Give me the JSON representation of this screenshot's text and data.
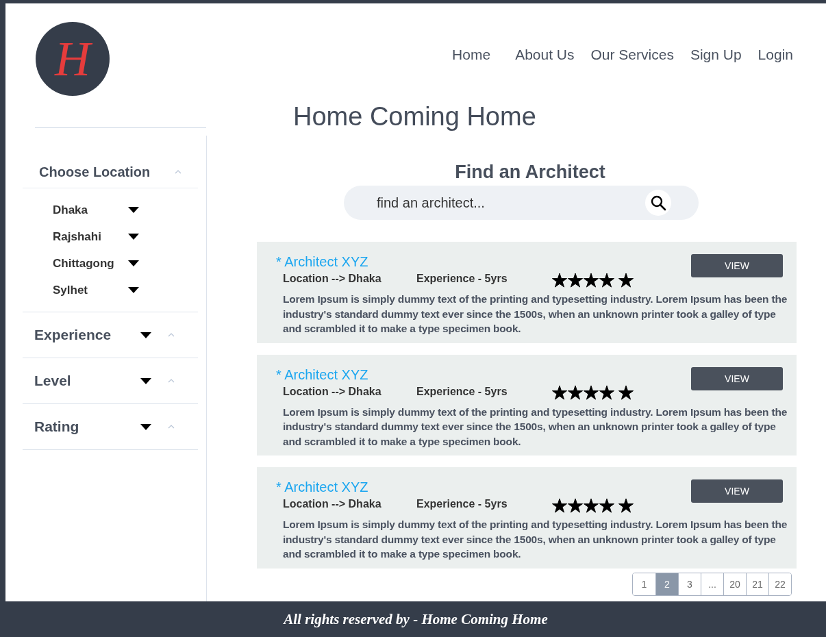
{
  "logo": {
    "letter": "H"
  },
  "nav": [
    "Home",
    "About Us",
    "Our Services",
    "Sign Up",
    "Login"
  ],
  "site_title": "Home Coming Home",
  "filters": [
    {
      "label": "Choose Location",
      "options": [
        "Dhaka",
        "Rajshahi",
        "Chittagong",
        "Sylhet"
      ]
    },
    {
      "label": "Experience"
    },
    {
      "label": "Level"
    },
    {
      "label": "Rating"
    }
  ],
  "search": {
    "heading": "Find an Architect",
    "placeholder": "find an architect..."
  },
  "architects": [
    {
      "name": "* Architect XYZ",
      "location": "Location -->  Dhaka",
      "experience": "Experience - 5yrs",
      "stars": 5,
      "description": "Lorem Ipsum is simply dummy text of the printing and typesetting industry. Lorem Ipsum has been the industry's standard dummy text ever since the 1500s, when an unknown printer took a galley of type and scrambled it to make a type specimen book.",
      "button": "VIEW"
    },
    {
      "name": "* Architect XYZ",
      "location": "Location -->  Dhaka",
      "experience": "Experience - 5yrs",
      "stars": 5,
      "description": "Lorem Ipsum is simply dummy text of the printing and typesetting industry. Lorem Ipsum has been the industry's standard dummy text ever since the 1500s, when an unknown printer took a galley of type and scrambled it to make a type specimen book.",
      "button": "VIEW"
    },
    {
      "name": "* Architect XYZ",
      "location": "Location -->  Dhaka",
      "experience": "Experience - 5yrs",
      "stars": 5,
      "description": "Lorem Ipsum is simply dummy text of the printing and typesetting industry. Lorem Ipsum has been the industry's standard dummy text ever since the 1500s, when an unknown printer took a galley of type and scrambled it to make a type specimen book.",
      "button": "VIEW"
    }
  ],
  "pagination": [
    {
      "label": "1",
      "selected": false
    },
    {
      "label": "2",
      "selected": true
    },
    {
      "label": "3",
      "selected": false
    },
    {
      "label": "...",
      "selected": false
    },
    {
      "label": "20",
      "selected": false
    },
    {
      "label": "21",
      "selected": false
    },
    {
      "label": "22",
      "selected": false
    }
  ],
  "footer": "All rights reserved by - Home  Coming Home"
}
